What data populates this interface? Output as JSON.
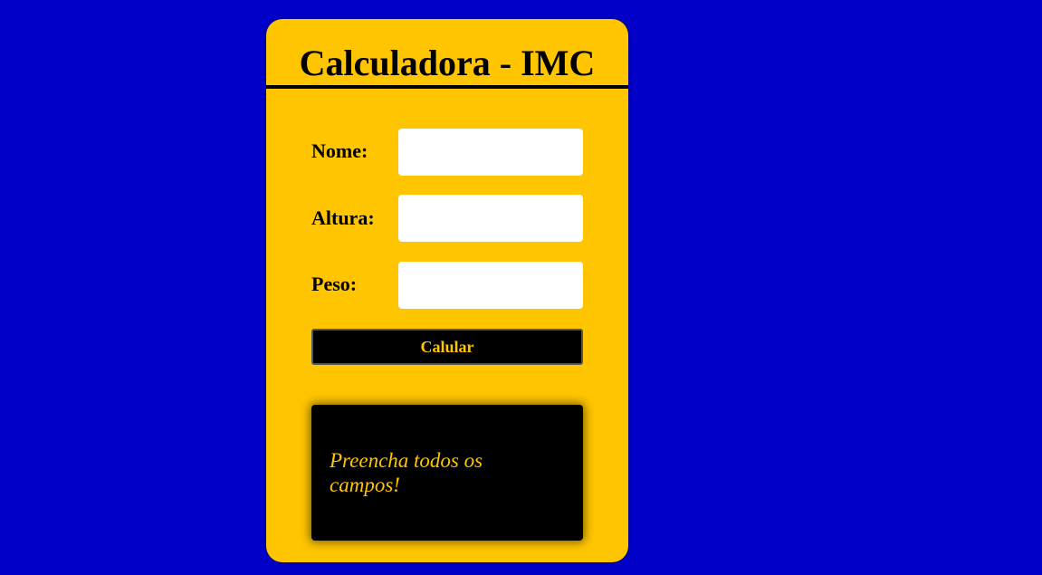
{
  "card": {
    "title": "Calculadora - IMC"
  },
  "form": {
    "name_label": "Nome:",
    "name_value": "",
    "height_label": "Altura:",
    "height_value": "",
    "weight_label": "Peso:",
    "weight_value": "",
    "submit_label": "Calular"
  },
  "result": {
    "message": "Preencha todos os campos!"
  },
  "colors": {
    "background": "#0000c8",
    "card": "#ffc500",
    "accent_text": "#ffc500",
    "dark": "#000000"
  }
}
